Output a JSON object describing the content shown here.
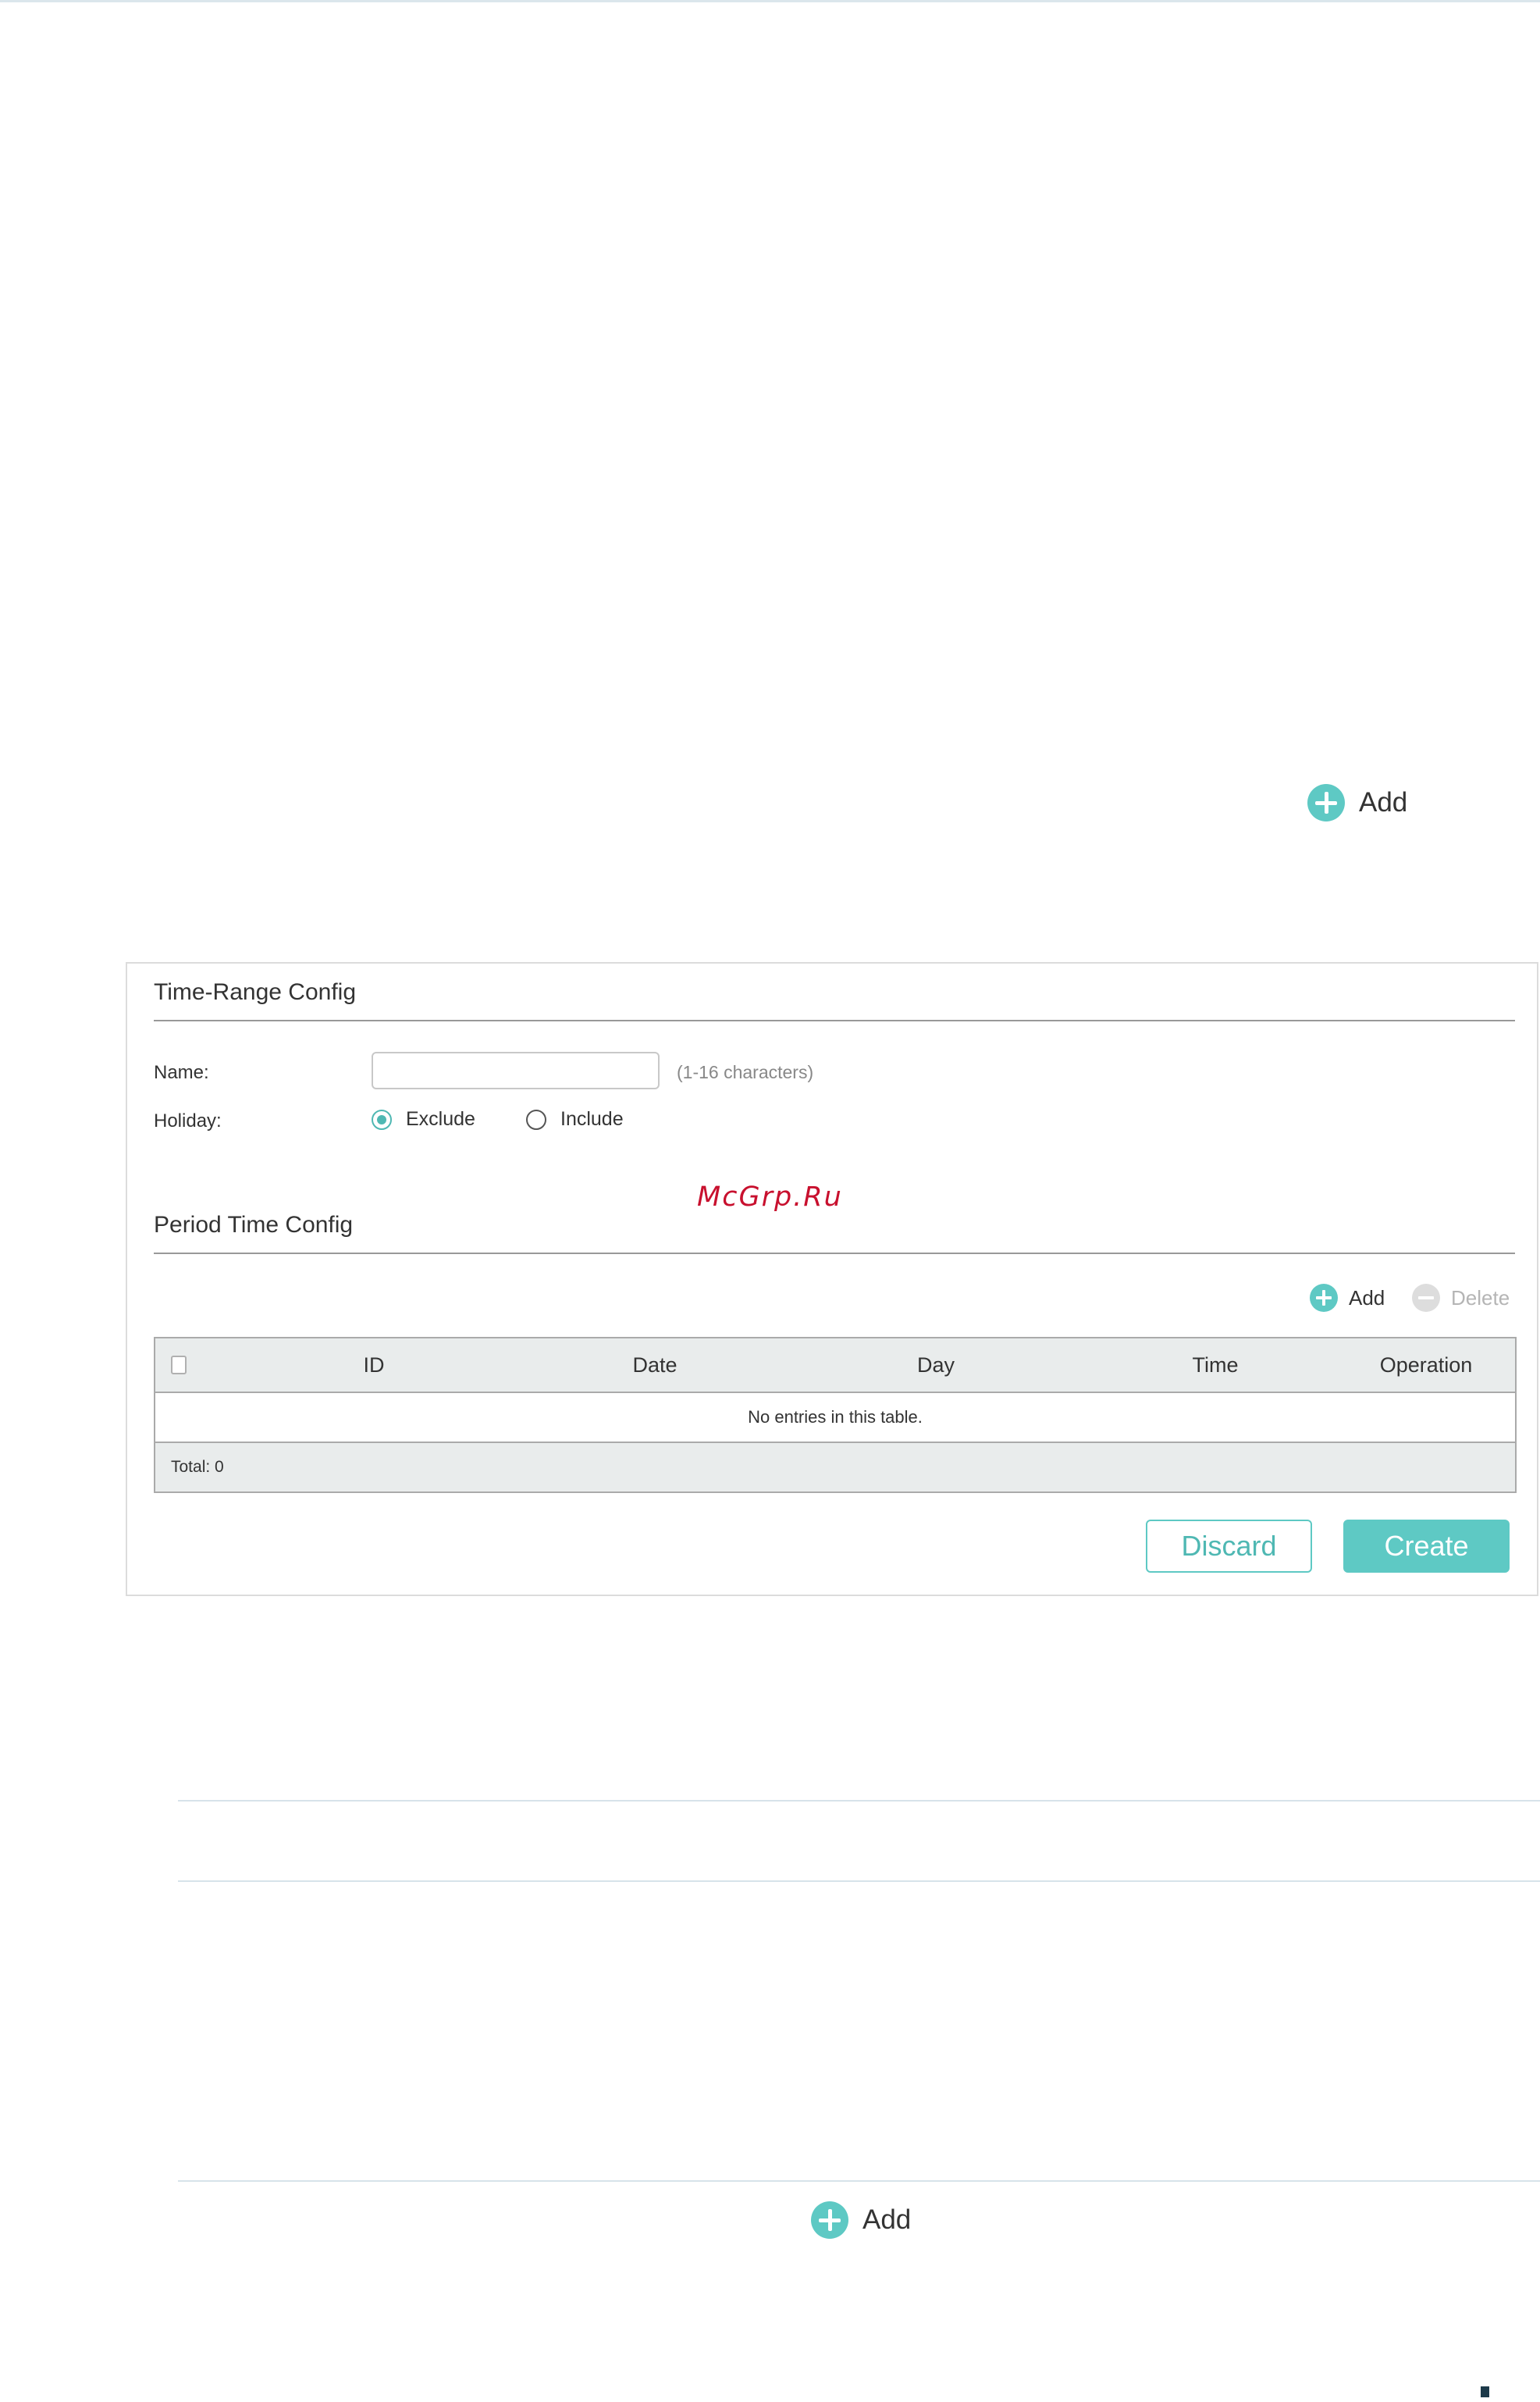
{
  "top_add": {
    "label": "Add"
  },
  "time_range": {
    "title": "Time-Range Config",
    "name_label": "Name:",
    "name_value": "",
    "name_hint": "(1-16 characters)",
    "holiday_label": "Holiday:",
    "holiday_options": [
      "Exclude",
      "Include"
    ],
    "holiday_selected": "Exclude"
  },
  "watermark": "McGrp.Ru",
  "period": {
    "title": "Period Time Config",
    "add_label": "Add",
    "delete_label": "Delete",
    "columns": [
      "ID",
      "Date",
      "Day",
      "Time",
      "Operation"
    ],
    "empty_text": "No entries in this table.",
    "total_text": "Total: 0"
  },
  "actions": {
    "discard_label": "Discard",
    "create_label": "Create"
  },
  "bottom_add": {
    "label": "Add"
  },
  "colors": {
    "accent": "#5ec9c4",
    "watermark": "#c8102e",
    "table_header_bg": "#e9ecec"
  }
}
